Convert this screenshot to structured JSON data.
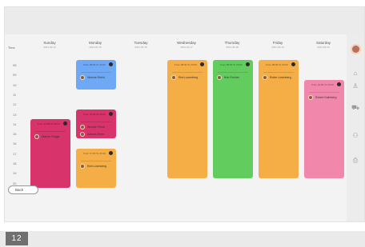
{
  "time_column": {
    "header": "Time",
    "hours": [
      "08",
      "09",
      "10",
      "11",
      "12",
      "13",
      "14",
      "15",
      "16",
      "17",
      "18",
      "19",
      "20",
      "21"
    ]
  },
  "days": [
    {
      "name": "Sunday",
      "date": "2021-03-14"
    },
    {
      "name": "Monday",
      "date": "2021-03-15"
    },
    {
      "name": "Tuesday",
      "date": "2021-03-16"
    },
    {
      "name": "Wednesday",
      "date": "2021-03-17"
    },
    {
      "name": "Thursday",
      "date": "2021-03-18"
    },
    {
      "name": "Friday",
      "date": "2021-03-19"
    },
    {
      "name": "Saturday",
      "date": "2021-03-20"
    }
  ],
  "blocks": [
    {
      "day": "Sunday",
      "color": "#d9336b",
      "time": "From 14:00 To 21:00",
      "people": [
        "Dianne Fixgge"
      ]
    },
    {
      "day": "Monday",
      "color": "#6fa8f5",
      "time": "From 08:00 To 11:00",
      "people": [
        "Nichole Robin"
      ]
    },
    {
      "day": "Monday",
      "color": "#d9336b",
      "time": "From 13:00 To 16:00",
      "people": [
        "Nichole Prime",
        "Aalvaro Rees"
      ]
    },
    {
      "day": "Monday",
      "color": "#f5ad45",
      "time": "From 17:00 To 21:00",
      "people": [
        "Rob Lusenberg"
      ]
    },
    {
      "day": "Wednesday",
      "color": "#f5ad45",
      "time": "From 08:00 To 20:00",
      "people": [
        "Rob Lusenberg"
      ]
    },
    {
      "day": "Thursday",
      "color": "#62cc5e",
      "time": "From 08:00 To 20:00",
      "people": [
        "Bob Fincher"
      ]
    },
    {
      "day": "Friday",
      "color": "#f5ad45",
      "time": "From 08:00 To 20:00",
      "people": [
        "Robin Lusenberg"
      ]
    },
    {
      "day": "Saturday",
      "color": "#f287ac",
      "time": "From 10:00 To 20:00",
      "people": [
        "Robert Kalmberg"
      ]
    }
  ],
  "right_panel_icons": [
    "user-avatar",
    "home-icon",
    "user-icon",
    "truck-icon",
    "group-icon",
    "camera-icon"
  ],
  "back_label": "Back",
  "footer_badge": "12"
}
